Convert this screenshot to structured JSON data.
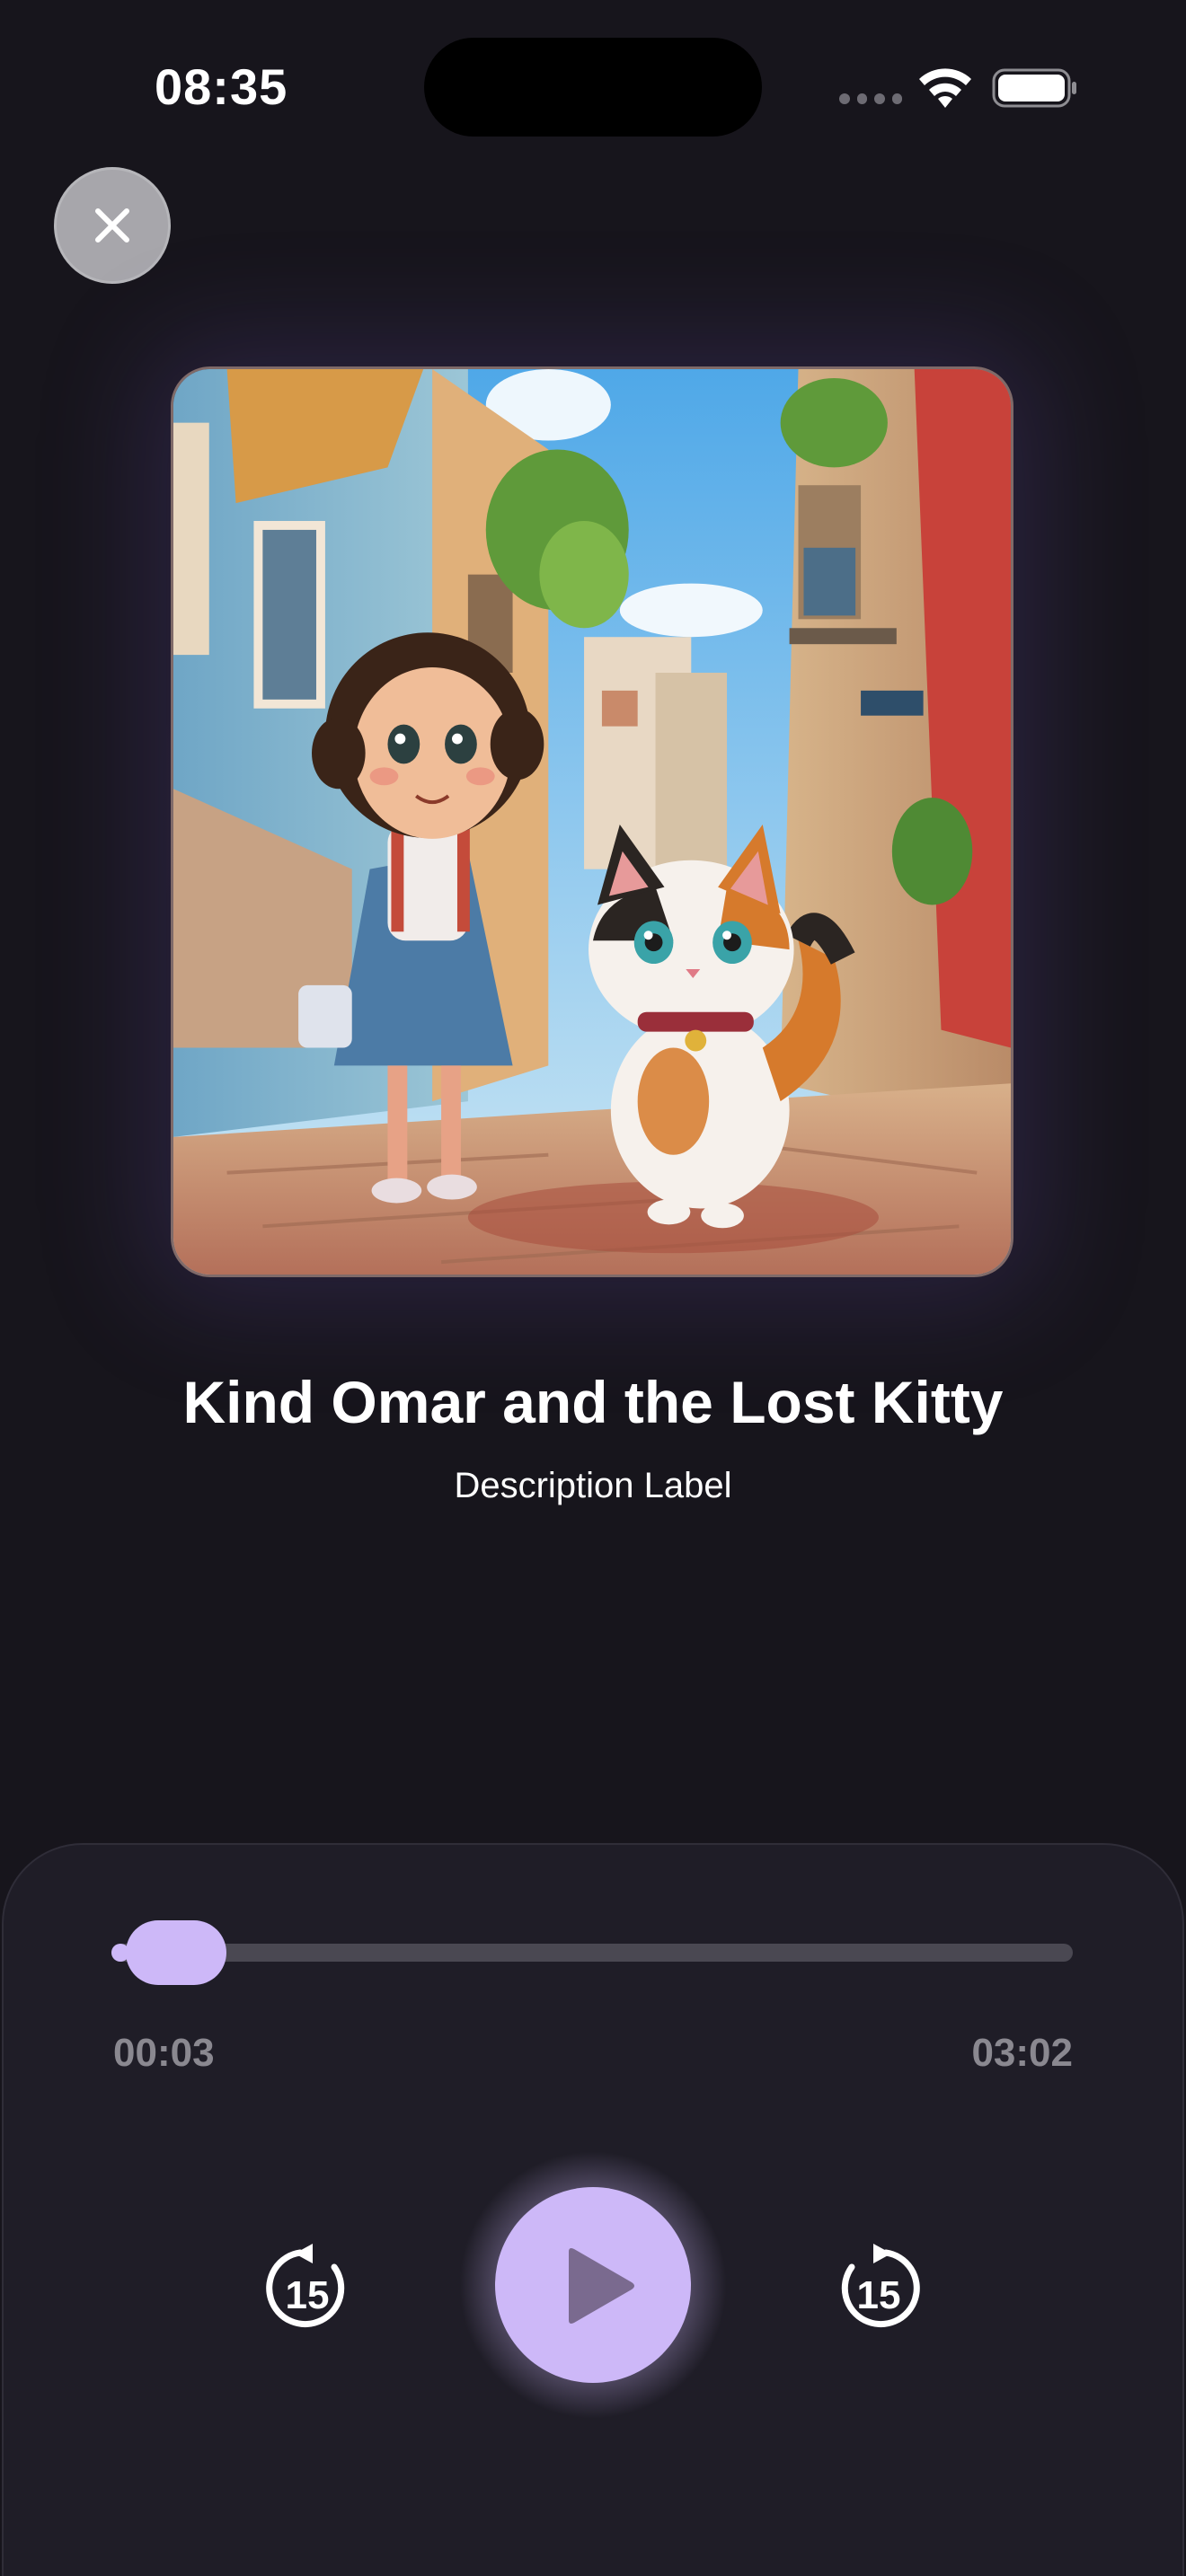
{
  "status_bar": {
    "time": "08:35",
    "wifi_icon": "wifi-icon",
    "battery_icon": "battery-icon"
  },
  "header": {
    "close_icon": "close-icon"
  },
  "story": {
    "cover_image": "girl-and-calico-kitten-on-street",
    "title": "Kind Omar and the Lost Kitty",
    "description": "Description Label"
  },
  "player": {
    "current_time": "00:03",
    "total_time": "03:02",
    "progress_fraction": 0.0165,
    "skip_back_seconds": "15",
    "skip_forward_seconds": "15",
    "play_icon": "play-icon",
    "accent_color": "#cdb8f8",
    "track_color": "#4a4852"
  }
}
